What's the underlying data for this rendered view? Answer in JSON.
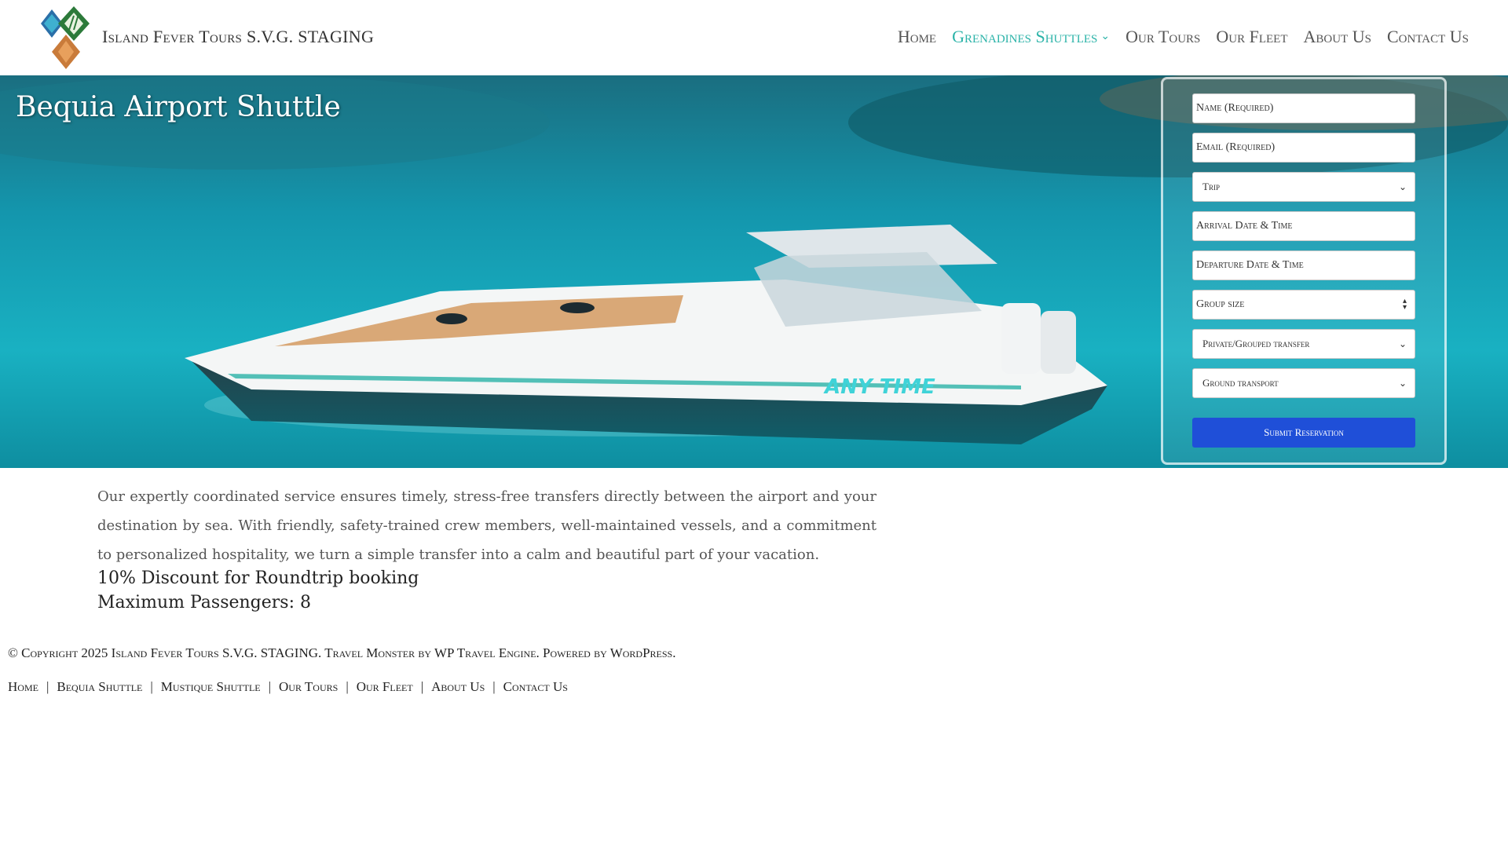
{
  "header": {
    "site_title": "Island Fever Tours S.V.G. STAGING",
    "nav": [
      {
        "label": "Home",
        "active": false
      },
      {
        "label": "Grenadines Shuttles",
        "active": true,
        "has_dropdown": true
      },
      {
        "label": "Our Tours",
        "active": false
      },
      {
        "label": "Our Fleet",
        "active": false
      },
      {
        "label": "About Us",
        "active": false
      },
      {
        "label": "Contact Us",
        "active": false
      }
    ]
  },
  "hero": {
    "title": "Bequia Airport Shuttle"
  },
  "form": {
    "name_placeholder": "Name (Required)",
    "email_placeholder": "Email (Required)",
    "trip_select": "Trip",
    "arrival_placeholder": "Arrival Date & Time",
    "departure_placeholder": "Departure Date & Time",
    "group_size_placeholder": "Group size",
    "transfer_select": "Private/Grouped transfer",
    "ground_select": "Ground transport",
    "submit_label": "Submit Reservation"
  },
  "content": {
    "paragraph": "Our expertly coordinated service ensures timely, stress-free transfers directly between the airport and your destination by sea. With friendly, safety-trained crew members, well-maintained vessels, and a commitment to personalized hospitality, we turn a simple transfer into a calm and beautiful part of your vacation.",
    "discount": "10% Discount for Roundtrip booking",
    "max_passengers": "Maximum Passengers: 8"
  },
  "footer": {
    "copyright": "© Copyright 2025 Island Fever Tours S.V.G. STAGING. Travel Monster by WP Travel Engine. Powered by WordPress.",
    "links": [
      "Home",
      "Bequia Shuttle",
      "Mustique Shuttle",
      "Our Tours",
      "Our Fleet",
      "About Us",
      "Contact Us"
    ],
    "separator": "|"
  },
  "colors": {
    "accent": "#2bb3a8",
    "submit": "#1f4fd8",
    "sea": "#12a3b4"
  }
}
